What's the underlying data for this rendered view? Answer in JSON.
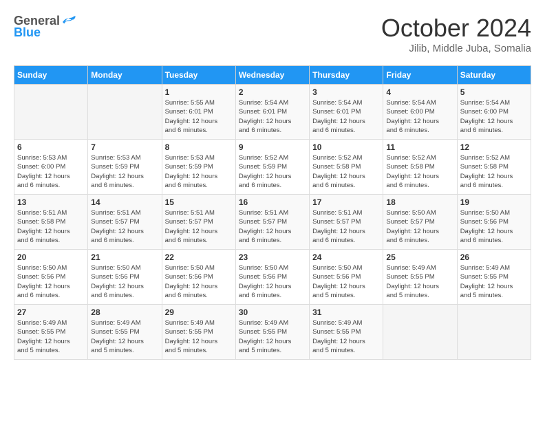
{
  "header": {
    "logo_general": "General",
    "logo_blue": "Blue",
    "title": "October 2024",
    "subtitle": "Jilib, Middle Juba, Somalia"
  },
  "days_of_week": [
    "Sunday",
    "Monday",
    "Tuesday",
    "Wednesday",
    "Thursday",
    "Friday",
    "Saturday"
  ],
  "weeks": [
    [
      {
        "day": null,
        "info": null
      },
      {
        "day": null,
        "info": null
      },
      {
        "day": "1",
        "info": "Sunrise: 5:55 AM\nSunset: 6:01 PM\nDaylight: 12 hours\nand 6 minutes."
      },
      {
        "day": "2",
        "info": "Sunrise: 5:54 AM\nSunset: 6:01 PM\nDaylight: 12 hours\nand 6 minutes."
      },
      {
        "day": "3",
        "info": "Sunrise: 5:54 AM\nSunset: 6:01 PM\nDaylight: 12 hours\nand 6 minutes."
      },
      {
        "day": "4",
        "info": "Sunrise: 5:54 AM\nSunset: 6:00 PM\nDaylight: 12 hours\nand 6 minutes."
      },
      {
        "day": "5",
        "info": "Sunrise: 5:54 AM\nSunset: 6:00 PM\nDaylight: 12 hours\nand 6 minutes."
      }
    ],
    [
      {
        "day": "6",
        "info": "Sunrise: 5:53 AM\nSunset: 6:00 PM\nDaylight: 12 hours\nand 6 minutes."
      },
      {
        "day": "7",
        "info": "Sunrise: 5:53 AM\nSunset: 5:59 PM\nDaylight: 12 hours\nand 6 minutes."
      },
      {
        "day": "8",
        "info": "Sunrise: 5:53 AM\nSunset: 5:59 PM\nDaylight: 12 hours\nand 6 minutes."
      },
      {
        "day": "9",
        "info": "Sunrise: 5:52 AM\nSunset: 5:59 PM\nDaylight: 12 hours\nand 6 minutes."
      },
      {
        "day": "10",
        "info": "Sunrise: 5:52 AM\nSunset: 5:58 PM\nDaylight: 12 hours\nand 6 minutes."
      },
      {
        "day": "11",
        "info": "Sunrise: 5:52 AM\nSunset: 5:58 PM\nDaylight: 12 hours\nand 6 minutes."
      },
      {
        "day": "12",
        "info": "Sunrise: 5:52 AM\nSunset: 5:58 PM\nDaylight: 12 hours\nand 6 minutes."
      }
    ],
    [
      {
        "day": "13",
        "info": "Sunrise: 5:51 AM\nSunset: 5:58 PM\nDaylight: 12 hours\nand 6 minutes."
      },
      {
        "day": "14",
        "info": "Sunrise: 5:51 AM\nSunset: 5:57 PM\nDaylight: 12 hours\nand 6 minutes."
      },
      {
        "day": "15",
        "info": "Sunrise: 5:51 AM\nSunset: 5:57 PM\nDaylight: 12 hours\nand 6 minutes."
      },
      {
        "day": "16",
        "info": "Sunrise: 5:51 AM\nSunset: 5:57 PM\nDaylight: 12 hours\nand 6 minutes."
      },
      {
        "day": "17",
        "info": "Sunrise: 5:51 AM\nSunset: 5:57 PM\nDaylight: 12 hours\nand 6 minutes."
      },
      {
        "day": "18",
        "info": "Sunrise: 5:50 AM\nSunset: 5:57 PM\nDaylight: 12 hours\nand 6 minutes."
      },
      {
        "day": "19",
        "info": "Sunrise: 5:50 AM\nSunset: 5:56 PM\nDaylight: 12 hours\nand 6 minutes."
      }
    ],
    [
      {
        "day": "20",
        "info": "Sunrise: 5:50 AM\nSunset: 5:56 PM\nDaylight: 12 hours\nand 6 minutes."
      },
      {
        "day": "21",
        "info": "Sunrise: 5:50 AM\nSunset: 5:56 PM\nDaylight: 12 hours\nand 6 minutes."
      },
      {
        "day": "22",
        "info": "Sunrise: 5:50 AM\nSunset: 5:56 PM\nDaylight: 12 hours\nand 6 minutes."
      },
      {
        "day": "23",
        "info": "Sunrise: 5:50 AM\nSunset: 5:56 PM\nDaylight: 12 hours\nand 6 minutes."
      },
      {
        "day": "24",
        "info": "Sunrise: 5:50 AM\nSunset: 5:56 PM\nDaylight: 12 hours\nand 5 minutes."
      },
      {
        "day": "25",
        "info": "Sunrise: 5:49 AM\nSunset: 5:55 PM\nDaylight: 12 hours\nand 5 minutes."
      },
      {
        "day": "26",
        "info": "Sunrise: 5:49 AM\nSunset: 5:55 PM\nDaylight: 12 hours\nand 5 minutes."
      }
    ],
    [
      {
        "day": "27",
        "info": "Sunrise: 5:49 AM\nSunset: 5:55 PM\nDaylight: 12 hours\nand 5 minutes."
      },
      {
        "day": "28",
        "info": "Sunrise: 5:49 AM\nSunset: 5:55 PM\nDaylight: 12 hours\nand 5 minutes."
      },
      {
        "day": "29",
        "info": "Sunrise: 5:49 AM\nSunset: 5:55 PM\nDaylight: 12 hours\nand 5 minutes."
      },
      {
        "day": "30",
        "info": "Sunrise: 5:49 AM\nSunset: 5:55 PM\nDaylight: 12 hours\nand 5 minutes."
      },
      {
        "day": "31",
        "info": "Sunrise: 5:49 AM\nSunset: 5:55 PM\nDaylight: 12 hours\nand 5 minutes."
      },
      {
        "day": null,
        "info": null
      },
      {
        "day": null,
        "info": null
      }
    ]
  ]
}
